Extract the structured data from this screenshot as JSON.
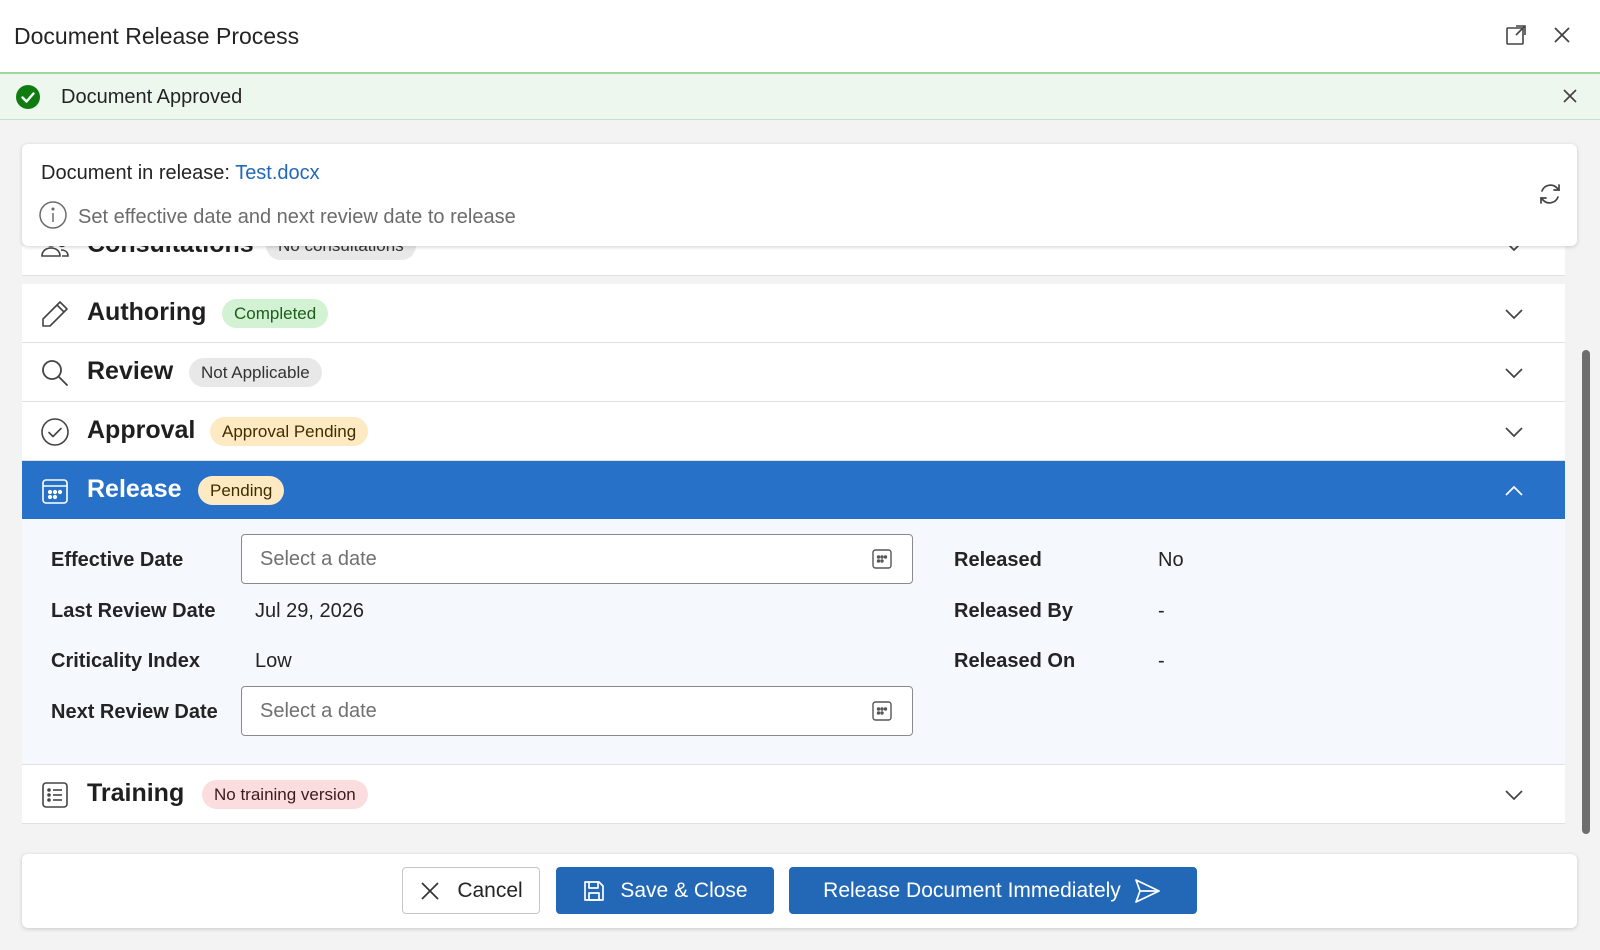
{
  "window": {
    "title": "Document Release Process",
    "expand_icon": "expand-icon",
    "close_icon": "close-icon"
  },
  "banner": {
    "message": "Document Approved",
    "status_color": "#107c10",
    "icon": "check-circle-icon",
    "dismiss_icon": "close-icon"
  },
  "info": {
    "prefix": "Document in release: ",
    "document_name": "Test.docx",
    "hint": "Set effective date and next review date to release",
    "hint_icon": "info-icon",
    "refresh_icon": "refresh-icon"
  },
  "sections": {
    "consultations": {
      "title": "Consultations",
      "badge": "No consultations",
      "icon": "people-icon"
    },
    "authoring": {
      "title": "Authoring",
      "badge": "Completed",
      "icon": "pencil-icon"
    },
    "review": {
      "title": "Review",
      "badge": "Not Applicable",
      "icon": "search-icon"
    },
    "approval": {
      "title": "Approval",
      "badge": "Approval Pending",
      "icon": "check-circle-outline-icon"
    },
    "release": {
      "title": "Release",
      "badge": "Pending",
      "icon": "calendar-icon",
      "expanded": true,
      "accent": "#2871c8"
    },
    "training": {
      "title": "Training",
      "badge": "No training version",
      "icon": "list-icon"
    }
  },
  "release_form": {
    "effective_date": {
      "label": "Effective Date",
      "placeholder": "Select a date",
      "value": ""
    },
    "last_review_date": {
      "label": "Last Review Date",
      "value": "Jul 29, 2026"
    },
    "criticality_index": {
      "label": "Criticality Index",
      "value": "Low"
    },
    "next_review_date": {
      "label": "Next Review Date",
      "placeholder": "Select a date",
      "value": ""
    },
    "released": {
      "label": "Released",
      "value": "No"
    },
    "released_by": {
      "label": "Released By",
      "value": "-"
    },
    "released_on": {
      "label": "Released On",
      "value": "-"
    }
  },
  "footer": {
    "cancel_label": "Cancel",
    "save_label": "Save & Close",
    "release_label": "Release Document Immediately",
    "primary_color": "#2368b6"
  }
}
